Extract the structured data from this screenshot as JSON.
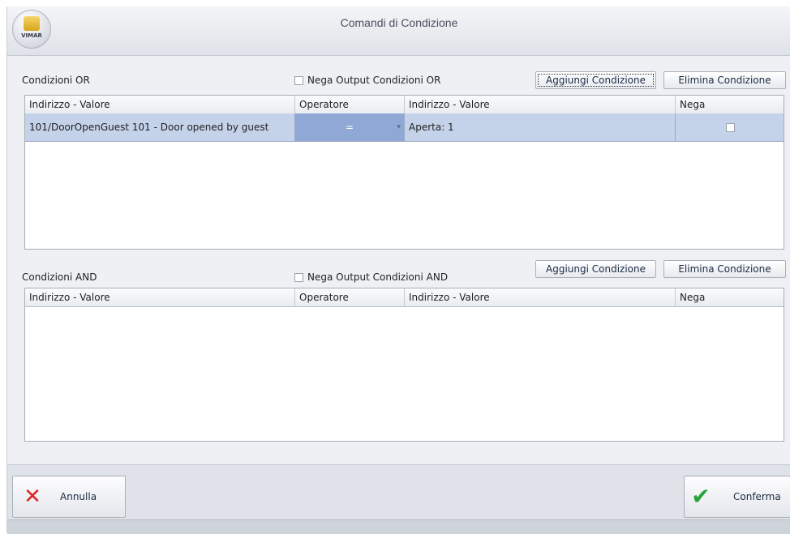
{
  "window": {
    "title": "Comandi di Condizione",
    "logo_text": "VIMAR"
  },
  "or_section": {
    "label": "Condizioni OR",
    "negate_label": "Nega Output Condizioni OR",
    "add_button": "Aggiungi Condizione",
    "delete_button": "Elimina Condizione",
    "columns": [
      "Indirizzo - Valore",
      "Operatore",
      "Indirizzo - Valore",
      "Nega"
    ],
    "rows": [
      {
        "address": "101/DoorOpenGuest 101 - Door opened by guest",
        "operator": "=",
        "value": "Aperta: 1"
      }
    ]
  },
  "and_section": {
    "label": "Condizioni AND",
    "negate_label": "Nega Output Condizioni AND",
    "add_button": "Aggiungi Condizione",
    "delete_button": "Elimina Condizione",
    "columns": [
      "Indirizzo - Valore",
      "Operatore",
      "Indirizzo - Valore",
      "Nega"
    ]
  },
  "footer": {
    "cancel_label": "Annulla",
    "confirm_label": "Conferma"
  },
  "colors": {
    "selected_row": "#c5d3ea",
    "cancel_icon": "#e02424",
    "confirm_icon": "#26a33a"
  },
  "icons": {
    "cancel": "close-icon",
    "confirm": "checkmark-icon",
    "dropdown": "chevron-down-icon"
  }
}
